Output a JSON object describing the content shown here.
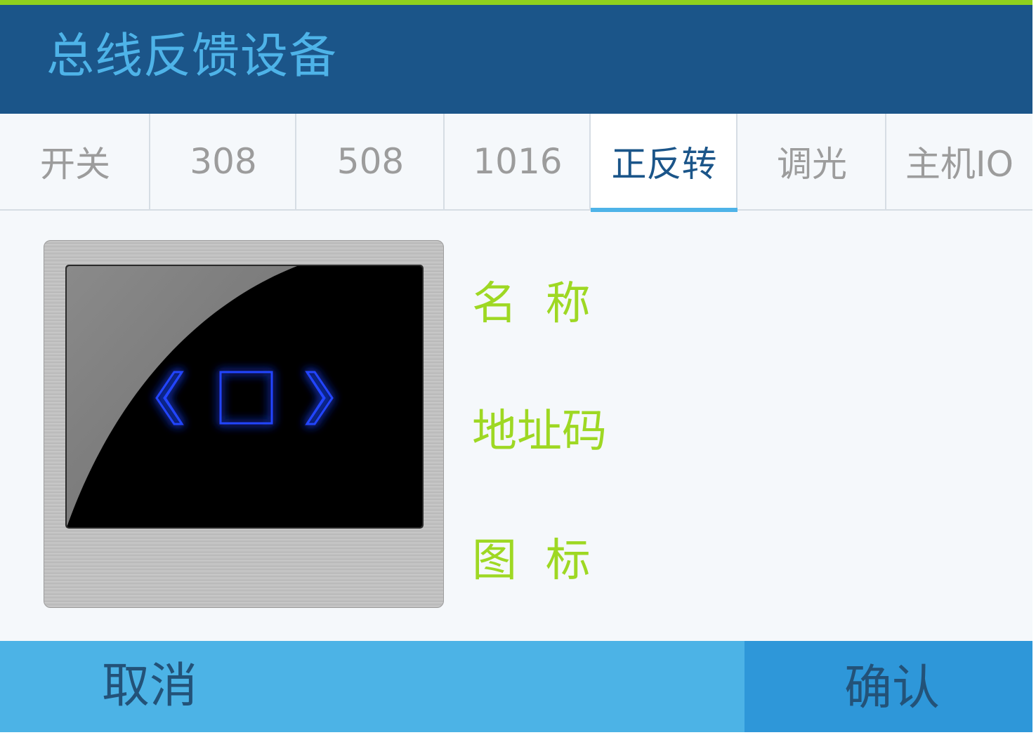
{
  "header": {
    "title": "总线反馈设备"
  },
  "tabs": [
    {
      "label": "开关",
      "active": false
    },
    {
      "label": "308",
      "active": false
    },
    {
      "label": "508",
      "active": false
    },
    {
      "label": "1016",
      "active": false
    },
    {
      "label": "正反转",
      "active": true
    },
    {
      "label": "调光",
      "active": false
    },
    {
      "label": "主机IO",
      "active": false
    }
  ],
  "fields": {
    "name_label": "名  称",
    "address_label": "地址码",
    "icon_label": "图  标"
  },
  "footer": {
    "cancel_label": "取消",
    "confirm_label": "确认"
  },
  "colors": {
    "header_bg": "#1b5589",
    "accent_green": "#8fd11e",
    "title_blue": "#4eb3e8",
    "label_green": "#9ed823",
    "cancel_bg": "#4cb3e6",
    "confirm_bg": "#2e97d9",
    "glow_blue": "#1a3cff"
  },
  "icons": {
    "device_left": "double-chevron-left-icon",
    "device_stop": "square-stop-icon",
    "device_right": "double-chevron-right-icon"
  }
}
